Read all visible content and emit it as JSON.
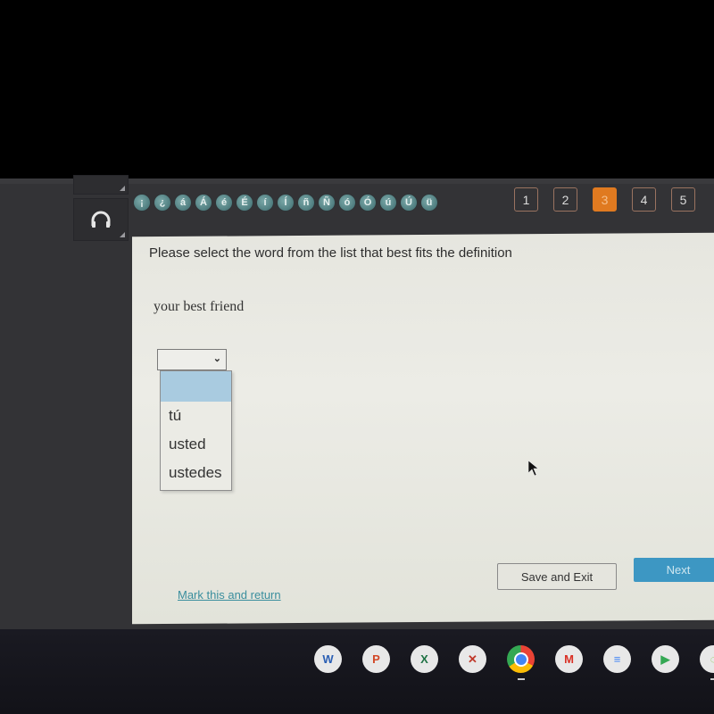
{
  "accent_buttons": [
    "¡",
    "¿",
    "á",
    "Á",
    "é",
    "É",
    "í",
    "Í",
    "ñ",
    "Ñ",
    "ó",
    "Ó",
    "ú",
    "Ú",
    "ü"
  ],
  "pager": {
    "pages": [
      "1",
      "2",
      "3",
      "4",
      "5"
    ],
    "active_page": "3"
  },
  "question": {
    "prompt": "Please select the word from the list that best fits the definition",
    "definition": "your best friend"
  },
  "answer_select": {
    "selected_value": "",
    "options": [
      "",
      "tú",
      "usted",
      "ustedes"
    ],
    "highlighted_option": ""
  },
  "footer": {
    "mark_link": "Mark this and return",
    "save_label": "Save and Exit",
    "next_label": "Next"
  },
  "colors": {
    "active_page": "#e07a20",
    "next_button": "#3d97c3",
    "link": "#3a8e9e",
    "accent_button": "#4f8080"
  },
  "shelf_apps": [
    {
      "name": "word",
      "glyph": "W",
      "color": "#2b5fb4"
    },
    {
      "name": "powerpoint",
      "glyph": "P",
      "color": "#d24726"
    },
    {
      "name": "excel",
      "glyph": "X",
      "color": "#1f7244"
    },
    {
      "name": "app-x",
      "glyph": "✕",
      "color": "#c0392b"
    },
    {
      "name": "chrome",
      "glyph": "●",
      "color": "#4285f4"
    },
    {
      "name": "gmail",
      "glyph": "M",
      "color": "#d93025"
    },
    {
      "name": "docs",
      "glyph": "≡",
      "color": "#4285f4"
    },
    {
      "name": "play-store",
      "glyph": "▶",
      "color": "#34a853"
    },
    {
      "name": "partial-app",
      "glyph": "◌",
      "color": "#8bc34a"
    }
  ]
}
